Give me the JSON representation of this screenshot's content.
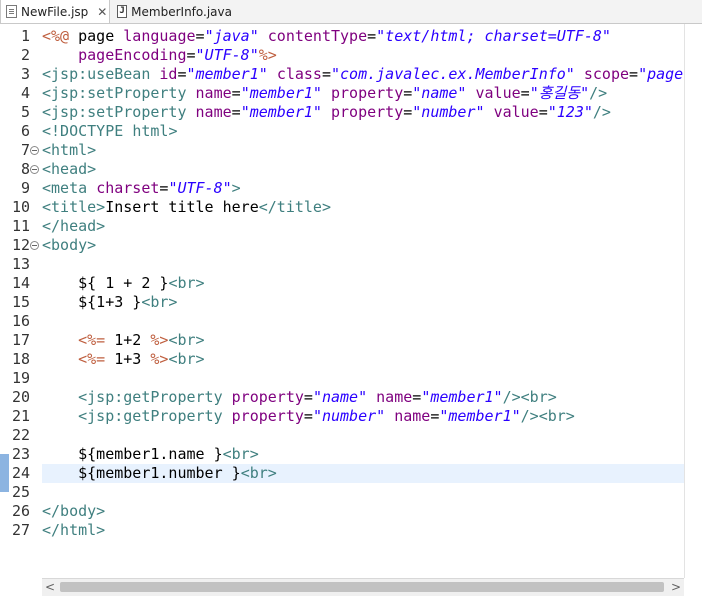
{
  "tabs": [
    {
      "label": "NewFile.jsp",
      "close": "✕",
      "icon": "jsp-file-icon"
    },
    {
      "label": "MemberInfo.java",
      "icon": "java-file-icon"
    }
  ],
  "code_lines": [
    {
      "n": "1",
      "segs": [
        [
          "d",
          "<%@ "
        ],
        [
          "p",
          "page "
        ],
        [
          "a",
          "language"
        ],
        [
          "p",
          "="
        ],
        [
          "v",
          "\"java\""
        ],
        [
          "p",
          " "
        ],
        [
          "a",
          "contentType"
        ],
        [
          "p",
          "="
        ],
        [
          "v",
          "\"text/html; charset=UTF-8\""
        ]
      ]
    },
    {
      "n": "2",
      "segs": [
        [
          "p",
          "    "
        ],
        [
          "a",
          "pageEncoding"
        ],
        [
          "p",
          "="
        ],
        [
          "v",
          "\"UTF-8\""
        ],
        [
          "d",
          "%>"
        ]
      ]
    },
    {
      "n": "3",
      "segs": [
        [
          "t",
          "<jsp:useBean "
        ],
        [
          "a",
          "id"
        ],
        [
          "p",
          "="
        ],
        [
          "v",
          "\"member1\""
        ],
        [
          "p",
          " "
        ],
        [
          "a",
          "class"
        ],
        [
          "p",
          "="
        ],
        [
          "v",
          "\"com.javalec.ex.MemberInfo\""
        ],
        [
          "p",
          " "
        ],
        [
          "a",
          "scope"
        ],
        [
          "p",
          "="
        ],
        [
          "v",
          "\"page"
        ]
      ]
    },
    {
      "n": "4",
      "segs": [
        [
          "t",
          "<jsp:setProperty "
        ],
        [
          "a",
          "name"
        ],
        [
          "p",
          "="
        ],
        [
          "v",
          "\"member1\""
        ],
        [
          "p",
          " "
        ],
        [
          "a",
          "property"
        ],
        [
          "p",
          "="
        ],
        [
          "v",
          "\"name\""
        ],
        [
          "p",
          " "
        ],
        [
          "a",
          "value"
        ],
        [
          "p",
          "="
        ],
        [
          "v",
          "\"홍길동\""
        ],
        [
          "t",
          "/>"
        ]
      ]
    },
    {
      "n": "5",
      "segs": [
        [
          "t",
          "<jsp:setProperty "
        ],
        [
          "a",
          "name"
        ],
        [
          "p",
          "="
        ],
        [
          "v",
          "\"member1\""
        ],
        [
          "p",
          " "
        ],
        [
          "a",
          "property"
        ],
        [
          "p",
          "="
        ],
        [
          "v",
          "\"number\""
        ],
        [
          "p",
          " "
        ],
        [
          "a",
          "value"
        ],
        [
          "p",
          "="
        ],
        [
          "v",
          "\"123\""
        ],
        [
          "t",
          "/>"
        ]
      ]
    },
    {
      "n": "6",
      "segs": [
        [
          "t",
          "<!DOCTYPE "
        ],
        [
          "t",
          "html"
        ],
        [
          "t",
          ">"
        ]
      ]
    },
    {
      "n": "7",
      "segs": [
        [
          "t",
          "<html>"
        ]
      ]
    },
    {
      "n": "8",
      "segs": [
        [
          "t",
          "<head>"
        ]
      ]
    },
    {
      "n": "9",
      "segs": [
        [
          "t",
          "<meta "
        ],
        [
          "a",
          "charset"
        ],
        [
          "p",
          "="
        ],
        [
          "v",
          "\"UTF-8\""
        ],
        [
          "t",
          ">"
        ]
      ]
    },
    {
      "n": "10",
      "segs": [
        [
          "t",
          "<title>"
        ],
        [
          "p",
          "Insert title here"
        ],
        [
          "t",
          "</title>"
        ]
      ]
    },
    {
      "n": "11",
      "segs": [
        [
          "t",
          "</head>"
        ]
      ]
    },
    {
      "n": "12",
      "segs": [
        [
          "t",
          "<body>"
        ]
      ]
    },
    {
      "n": "13",
      "segs": []
    },
    {
      "n": "14",
      "segs": [
        [
          "p",
          "    ${ 1 + 2 }"
        ],
        [
          "t",
          "<br>"
        ]
      ]
    },
    {
      "n": "15",
      "segs": [
        [
          "p",
          "    ${1+3 }"
        ],
        [
          "t",
          "<br>"
        ]
      ]
    },
    {
      "n": "16",
      "segs": []
    },
    {
      "n": "17",
      "segs": [
        [
          "p",
          "    "
        ],
        [
          "d",
          "<%="
        ],
        [
          "p",
          " 1+2 "
        ],
        [
          "d",
          "%>"
        ],
        [
          "t",
          "<br>"
        ]
      ]
    },
    {
      "n": "18",
      "segs": [
        [
          "p",
          "    "
        ],
        [
          "d",
          "<%="
        ],
        [
          "p",
          " 1+3 "
        ],
        [
          "d",
          "%>"
        ],
        [
          "t",
          "<br>"
        ]
      ]
    },
    {
      "n": "19",
      "segs": []
    },
    {
      "n": "20",
      "segs": [
        [
          "p",
          "    "
        ],
        [
          "t",
          "<jsp:getProperty "
        ],
        [
          "a",
          "property"
        ],
        [
          "p",
          "="
        ],
        [
          "v",
          "\"name\""
        ],
        [
          "p",
          " "
        ],
        [
          "a",
          "name"
        ],
        [
          "p",
          "="
        ],
        [
          "v",
          "\"member1\""
        ],
        [
          "t",
          "/><br>"
        ]
      ]
    },
    {
      "n": "21",
      "segs": [
        [
          "p",
          "    "
        ],
        [
          "t",
          "<jsp:getProperty "
        ],
        [
          "a",
          "property"
        ],
        [
          "p",
          "="
        ],
        [
          "v",
          "\"number\""
        ],
        [
          "p",
          " "
        ],
        [
          "a",
          "name"
        ],
        [
          "p",
          "="
        ],
        [
          "v",
          "\"member1\""
        ],
        [
          "t",
          "/><br>"
        ]
      ]
    },
    {
      "n": "22",
      "segs": []
    },
    {
      "n": "23",
      "segs": [
        [
          "p",
          "    ${member1.name }"
        ],
        [
          "t",
          "<br>"
        ]
      ]
    },
    {
      "n": "24",
      "segs": [
        [
          "p",
          "    ${member1.number }"
        ],
        [
          "t",
          "<br>"
        ]
      ]
    },
    {
      "n": "25",
      "segs": []
    },
    {
      "n": "26",
      "segs": [
        [
          "t",
          "</body>"
        ]
      ]
    },
    {
      "n": "27",
      "segs": [
        [
          "t",
          "</html>"
        ]
      ]
    }
  ],
  "fold_lines": [
    "7",
    "8",
    "12"
  ],
  "current_line": "24",
  "scroll": {
    "left_arrow": "<",
    "right_arrow": ">"
  },
  "colors": {
    "tag": "#3f7f7f",
    "attribute": "#7f007f",
    "value": "#2a00ff",
    "delimiter": "#bf5f3f",
    "current_line": "#e8f2fe"
  }
}
